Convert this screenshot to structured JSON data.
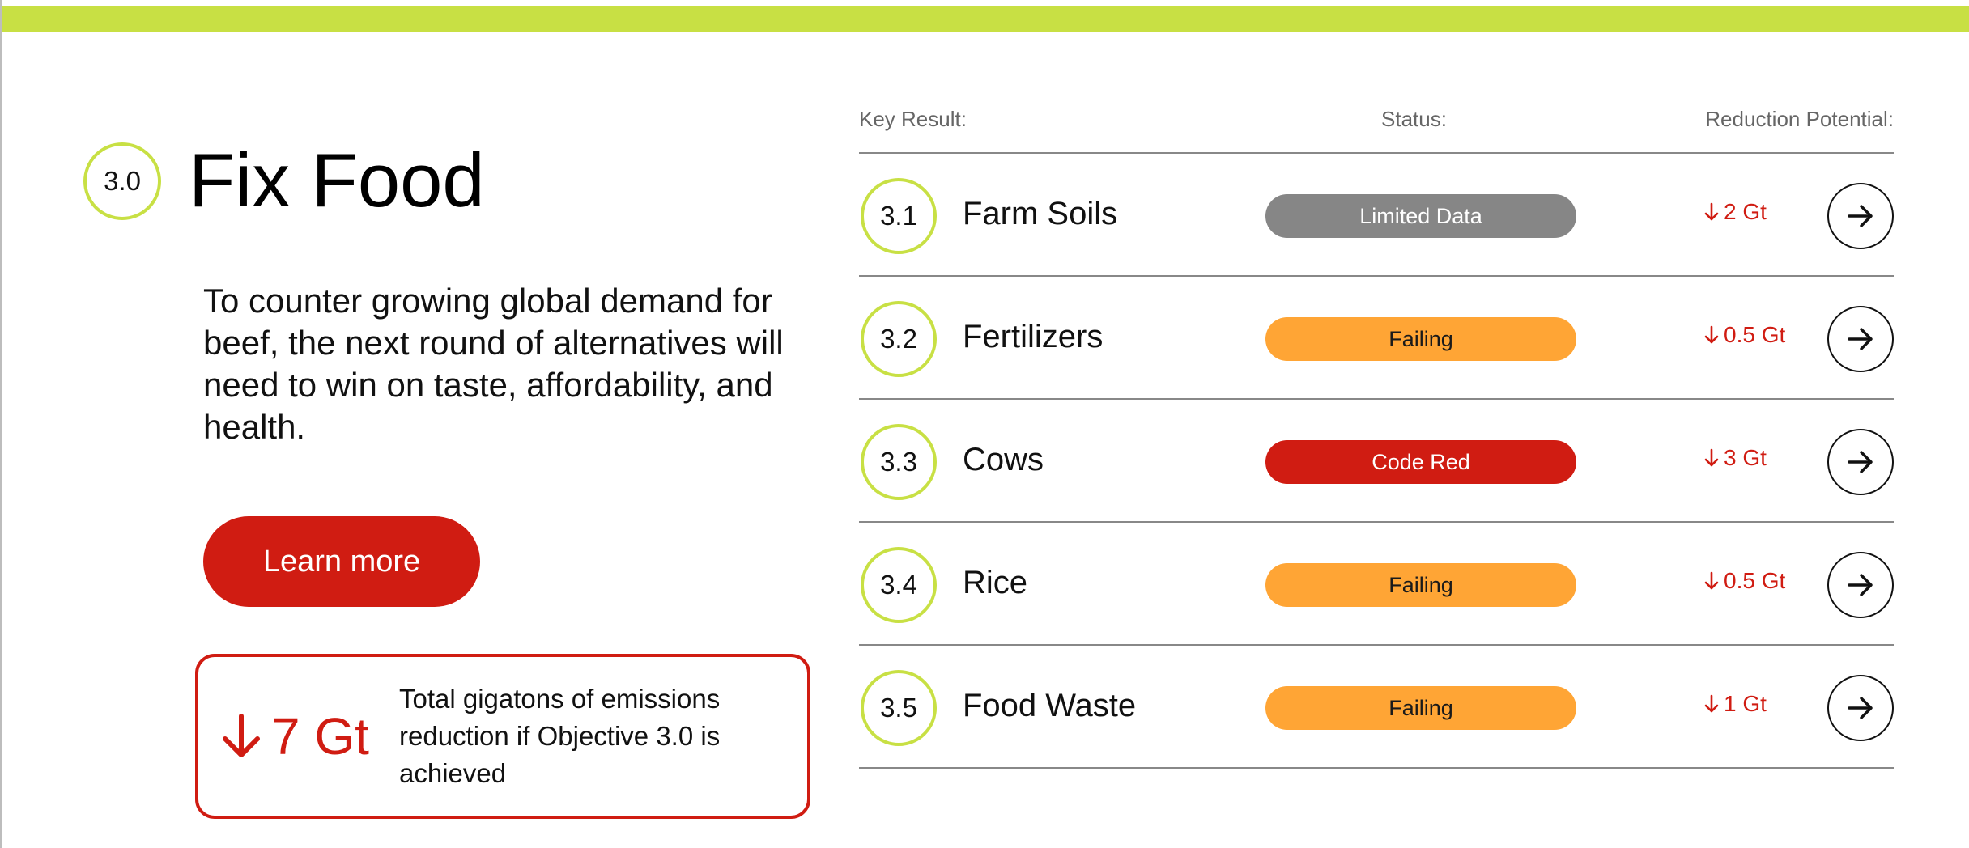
{
  "objective": {
    "number": "3.0",
    "title": "Fix Food",
    "description": "To counter growing global demand for beef, the next round of alternatives will need to win on taste, affordability, and health.",
    "cta_label": "Learn more",
    "total": {
      "value": "7 Gt",
      "text": "Total gigatons of emissions reduction if Objective 3.0 is achieved"
    }
  },
  "table": {
    "headers": {
      "key_result": "Key Result:",
      "status": "Status:",
      "reduction": "Reduction Potential:"
    },
    "rows": [
      {
        "number": "3.1",
        "label": "Farm Soils",
        "status": "Limited Data",
        "status_type": "limited",
        "reduction": "2 Gt"
      },
      {
        "number": "3.2",
        "label": "Fertilizers",
        "status": "Failing",
        "status_type": "failing",
        "reduction": "0.5 Gt"
      },
      {
        "number": "3.3",
        "label": "Cows",
        "status": "Code Red",
        "status_type": "codered",
        "reduction": "3 Gt"
      },
      {
        "number": "3.4",
        "label": "Rice",
        "status": "Failing",
        "status_type": "failing",
        "reduction": "0.5 Gt"
      },
      {
        "number": "3.5",
        "label": "Food Waste",
        "status": "Failing",
        "status_type": "failing",
        "reduction": "1 Gt"
      }
    ]
  },
  "icons": {
    "down_arrow": "arrow-down-icon",
    "row_arrow": "arrow-right-circle-icon"
  },
  "colors": {
    "accent_green": "#c8e044",
    "red": "#d01c12",
    "orange": "#ffa535",
    "gray": "#868686"
  }
}
